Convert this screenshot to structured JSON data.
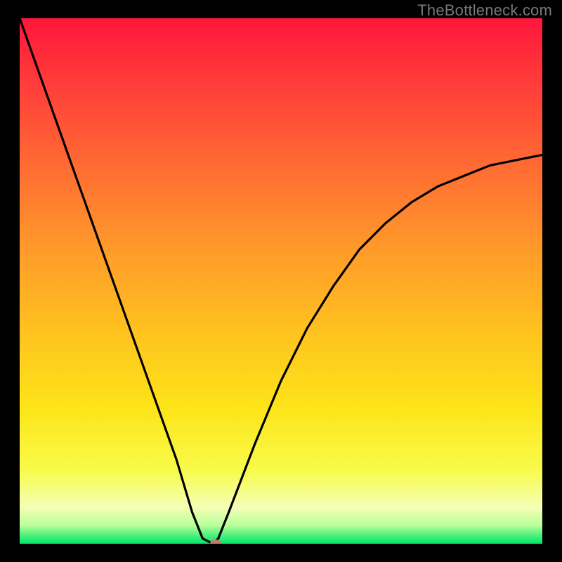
{
  "watermark": "TheBottleneck.com",
  "colors": {
    "frame": "#000000",
    "gradient_red": "#ff163b",
    "gradient_orange": "#ff8a2d",
    "gradient_yellow": "#fde91a",
    "gradient_lemon": "#f7ff99",
    "gradient_green": "#00e76a",
    "curve": "#000000",
    "marker": "#c47a6f"
  },
  "chart_data": {
    "type": "line",
    "title": "",
    "xlabel": "",
    "ylabel": "",
    "xlim": [
      0,
      100
    ],
    "ylim": [
      0,
      100
    ],
    "series": [
      {
        "name": "bottleneck-curve",
        "x": [
          0,
          5,
          10,
          15,
          20,
          25,
          30,
          33,
          35,
          37,
          38,
          40,
          45,
          50,
          55,
          60,
          65,
          70,
          75,
          80,
          85,
          90,
          95,
          100
        ],
        "values": [
          100,
          86,
          72,
          58,
          44,
          30,
          16,
          6,
          1,
          0,
          1,
          6,
          19,
          31,
          41,
          49,
          56,
          61,
          65,
          68,
          70,
          72,
          73,
          74
        ]
      }
    ],
    "marker": {
      "x": 37.5,
      "y": 0
    },
    "annotations": []
  }
}
